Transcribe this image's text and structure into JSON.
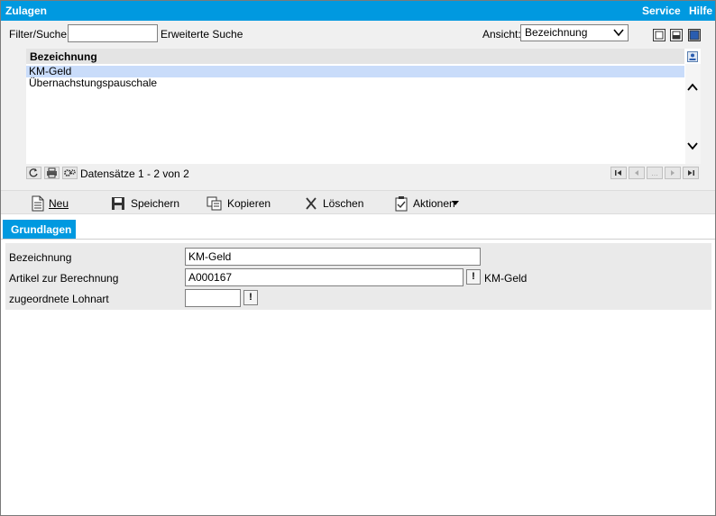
{
  "window": {
    "title": "Zulagen",
    "menu": [
      "Service",
      "Hilfe"
    ]
  },
  "filter": {
    "label": "Filter/Suche:",
    "value": "",
    "extended_search": "Erweiterte Suche",
    "view_label": "Ansicht:",
    "view_selected": "Bezeichnung"
  },
  "list": {
    "column_header": "Bezeichnung",
    "rows": [
      "KM-Geld",
      "Übernachstungspauschale"
    ],
    "selected_index": 0,
    "record_count": "Datensätze 1 - 2 von 2",
    "pager_ellipsis": "..."
  },
  "actions": {
    "new": "Neu",
    "save": "Speichern",
    "copy": "Kopieren",
    "delete": "Löschen",
    "more": "Aktionen"
  },
  "tabs": {
    "basics": "Grundlagen"
  },
  "form": {
    "name_label": "Bezeichnung",
    "name_value": "KM-Geld",
    "article_label": "Artikel zur Berechnung",
    "article_value": "A000167",
    "article_info": "KM-Geld",
    "wagetype_label": "zugeordnete Lohnart",
    "wagetype_value": "",
    "lookup_glyph": "!"
  },
  "colors": {
    "accent": "#0099e0",
    "selection": "#c9dcfa",
    "panel": "#f0f0f0"
  }
}
